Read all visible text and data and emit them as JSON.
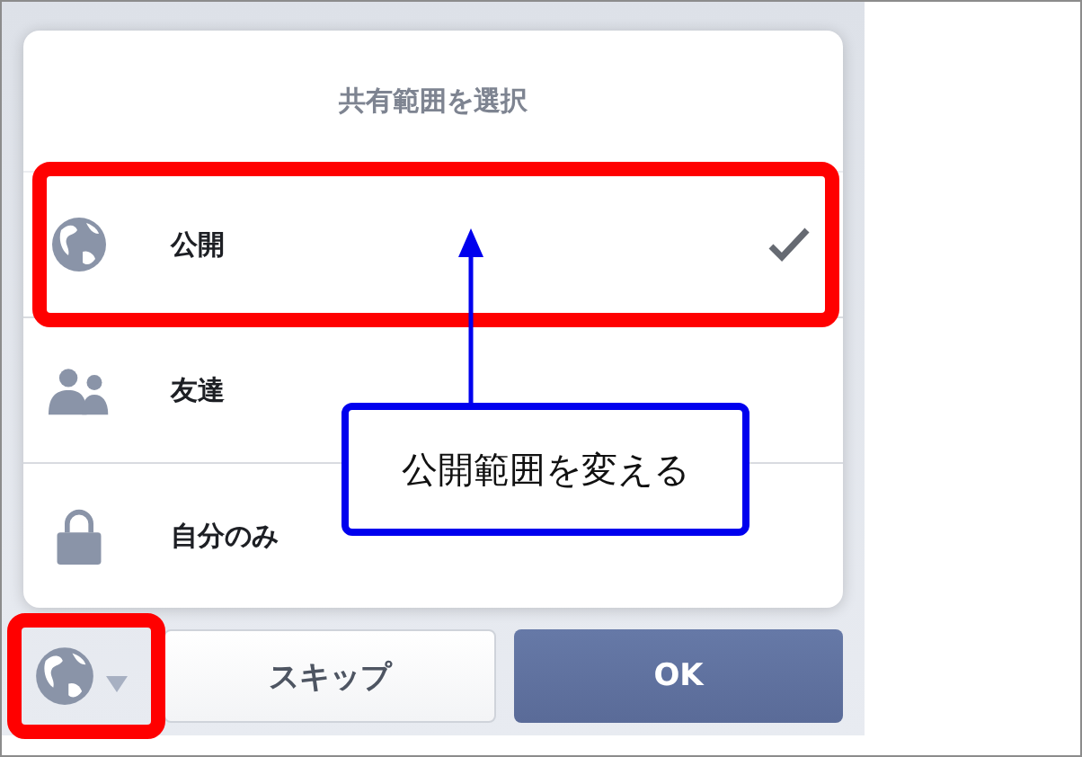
{
  "popover": {
    "title": "共有範囲を選択",
    "options": [
      {
        "kind": "globe",
        "label": "公開",
        "selected": true
      },
      {
        "kind": "people",
        "label": "友達",
        "selected": false
      },
      {
        "kind": "lock",
        "label": "自分のみ",
        "selected": false
      }
    ]
  },
  "bottom_bar": {
    "privacy_button": {
      "kind": "globe"
    },
    "buttons": [
      {
        "kind": "secondary",
        "label": "スキップ"
      },
      {
        "kind": "primary",
        "label": "OK"
      }
    ]
  },
  "annotation": {
    "callout": "公開範囲を変える"
  }
}
